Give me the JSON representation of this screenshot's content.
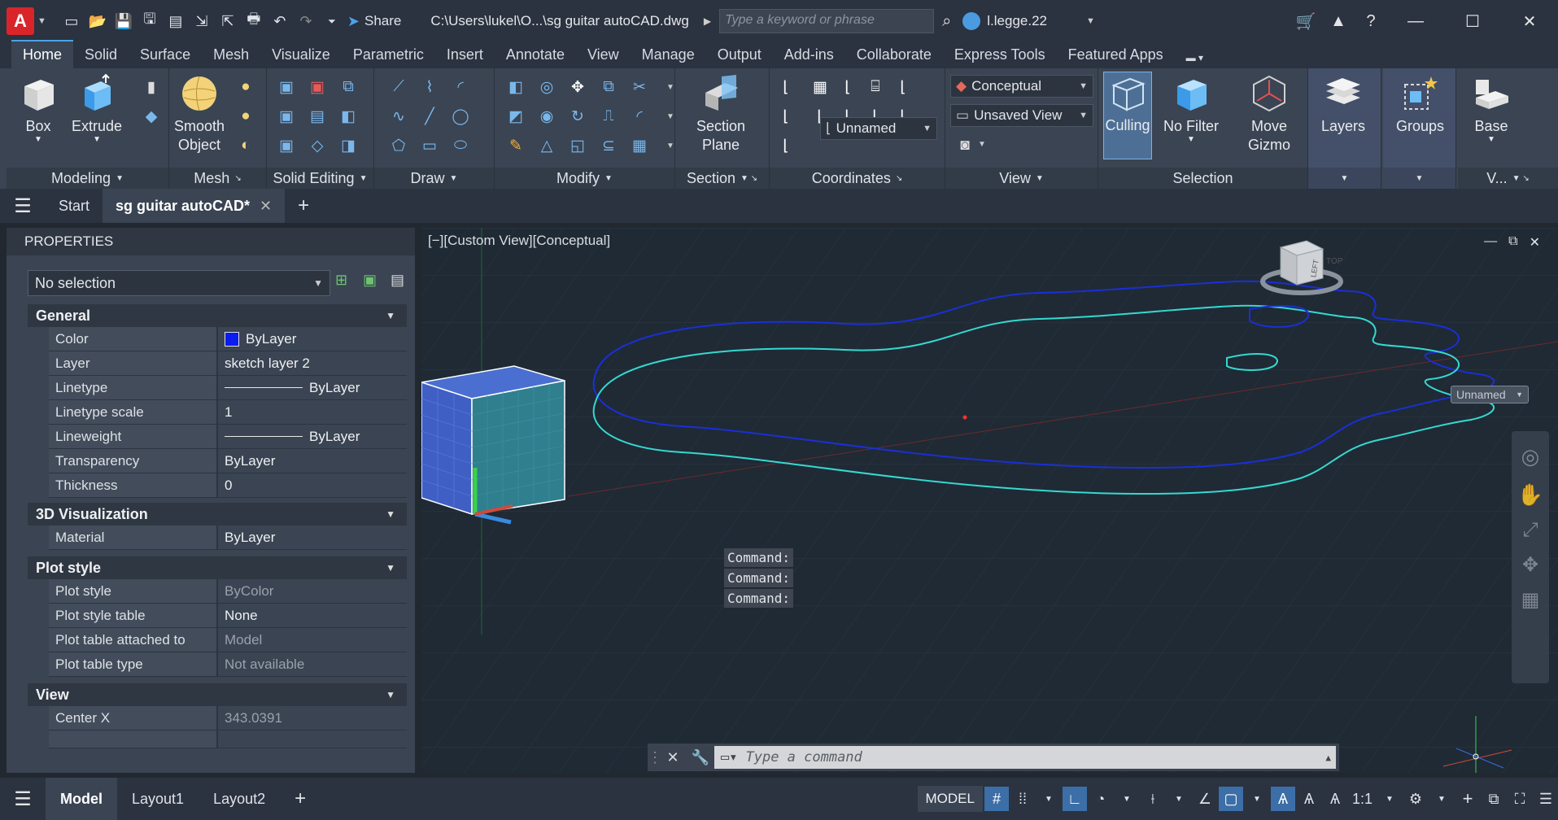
{
  "title_bar": {
    "app_logo": "A",
    "share_label": "Share",
    "file_path": "C:\\Users\\lukel\\O...\\sg guitar autoCAD.dwg",
    "search_placeholder": "Type a keyword or phrase",
    "user_name": "l.legge.22"
  },
  "ribbon_tabs": [
    "Home",
    "Solid",
    "Surface",
    "Mesh",
    "Visualize",
    "Parametric",
    "Insert",
    "Annotate",
    "View",
    "Manage",
    "Output",
    "Add-ins",
    "Collaborate",
    "Express Tools",
    "Featured Apps"
  ],
  "ribbon": {
    "modeling": {
      "label": "Modeling",
      "box": "Box",
      "extrude": "Extrude"
    },
    "mesh": {
      "label": "Mesh",
      "smooth_object_1": "Smooth",
      "smooth_object_2": "Object"
    },
    "solid_editing": {
      "label": "Solid Editing"
    },
    "draw": {
      "label": "Draw"
    },
    "modify": {
      "label": "Modify"
    },
    "section": {
      "label": "Section",
      "section_plane_1": "Section",
      "section_plane_2": "Plane"
    },
    "coordinates": {
      "label": "Coordinates",
      "ucs_name": "Unnamed"
    },
    "view": {
      "label": "View",
      "visual_style": "Conceptual",
      "named_view": "Unsaved View"
    },
    "selection": {
      "label": "Selection",
      "culling": "Culling",
      "no_filter": "No Filter",
      "move_gizmo_1": "Move",
      "move_gizmo_2": "Gizmo"
    },
    "layers": {
      "label": "Layers"
    },
    "groups": {
      "label": "Groups"
    },
    "base": {
      "label": "Base",
      "short_label": "V..."
    }
  },
  "doc_tabs": {
    "start": "Start",
    "active": "sg guitar autoCAD*"
  },
  "properties": {
    "header": "PROPERTIES",
    "selection": "No selection",
    "sections": {
      "general": "General",
      "visualization": "3D Visualization",
      "plot_style": "Plot style",
      "view": "View"
    },
    "general": {
      "color": {
        "k": "Color",
        "v": "ByLayer"
      },
      "layer": {
        "k": "Layer",
        "v": "sketch layer 2"
      },
      "linetype": {
        "k": "Linetype",
        "v": "ByLayer"
      },
      "linetype_scale": {
        "k": "Linetype scale",
        "v": "1"
      },
      "lineweight": {
        "k": "Lineweight",
        "v": "ByLayer"
      },
      "transparency": {
        "k": "Transparency",
        "v": "ByLayer"
      },
      "thickness": {
        "k": "Thickness",
        "v": "0"
      }
    },
    "visualization": {
      "material": {
        "k": "Material",
        "v": "ByLayer"
      }
    },
    "plot": {
      "plot_style": {
        "k": "Plot style",
        "v": "ByColor"
      },
      "plot_style_table": {
        "k": "Plot style table",
        "v": "None"
      },
      "plot_table_attached": {
        "k": "Plot table attached to",
        "v": "Model"
      },
      "plot_table_type": {
        "k": "Plot table type",
        "v": "Not available"
      }
    },
    "view": {
      "center_x": {
        "k": "Center X",
        "v": "343.0391"
      }
    }
  },
  "viewport": {
    "label": "[−][Custom View][Conceptual]",
    "ucs_badge": "Unnamed",
    "viewcube_left": "LEFT",
    "viewcube_top": "TOP",
    "command_history": [
      "Command:",
      "Command:",
      "Command:"
    ],
    "command_placeholder": "Type a command"
  },
  "status_bar": {
    "layouts": [
      "Model",
      "Layout1",
      "Layout2"
    ],
    "model_label": "MODEL",
    "scale": "1:1"
  },
  "colors": {
    "accent": "#4aa3e8",
    "logo": "#d9252a",
    "bylayer_swatch": "#0b1cf0",
    "curve_blue": "#1a2fd6",
    "curve_cyan": "#35d9d0"
  }
}
